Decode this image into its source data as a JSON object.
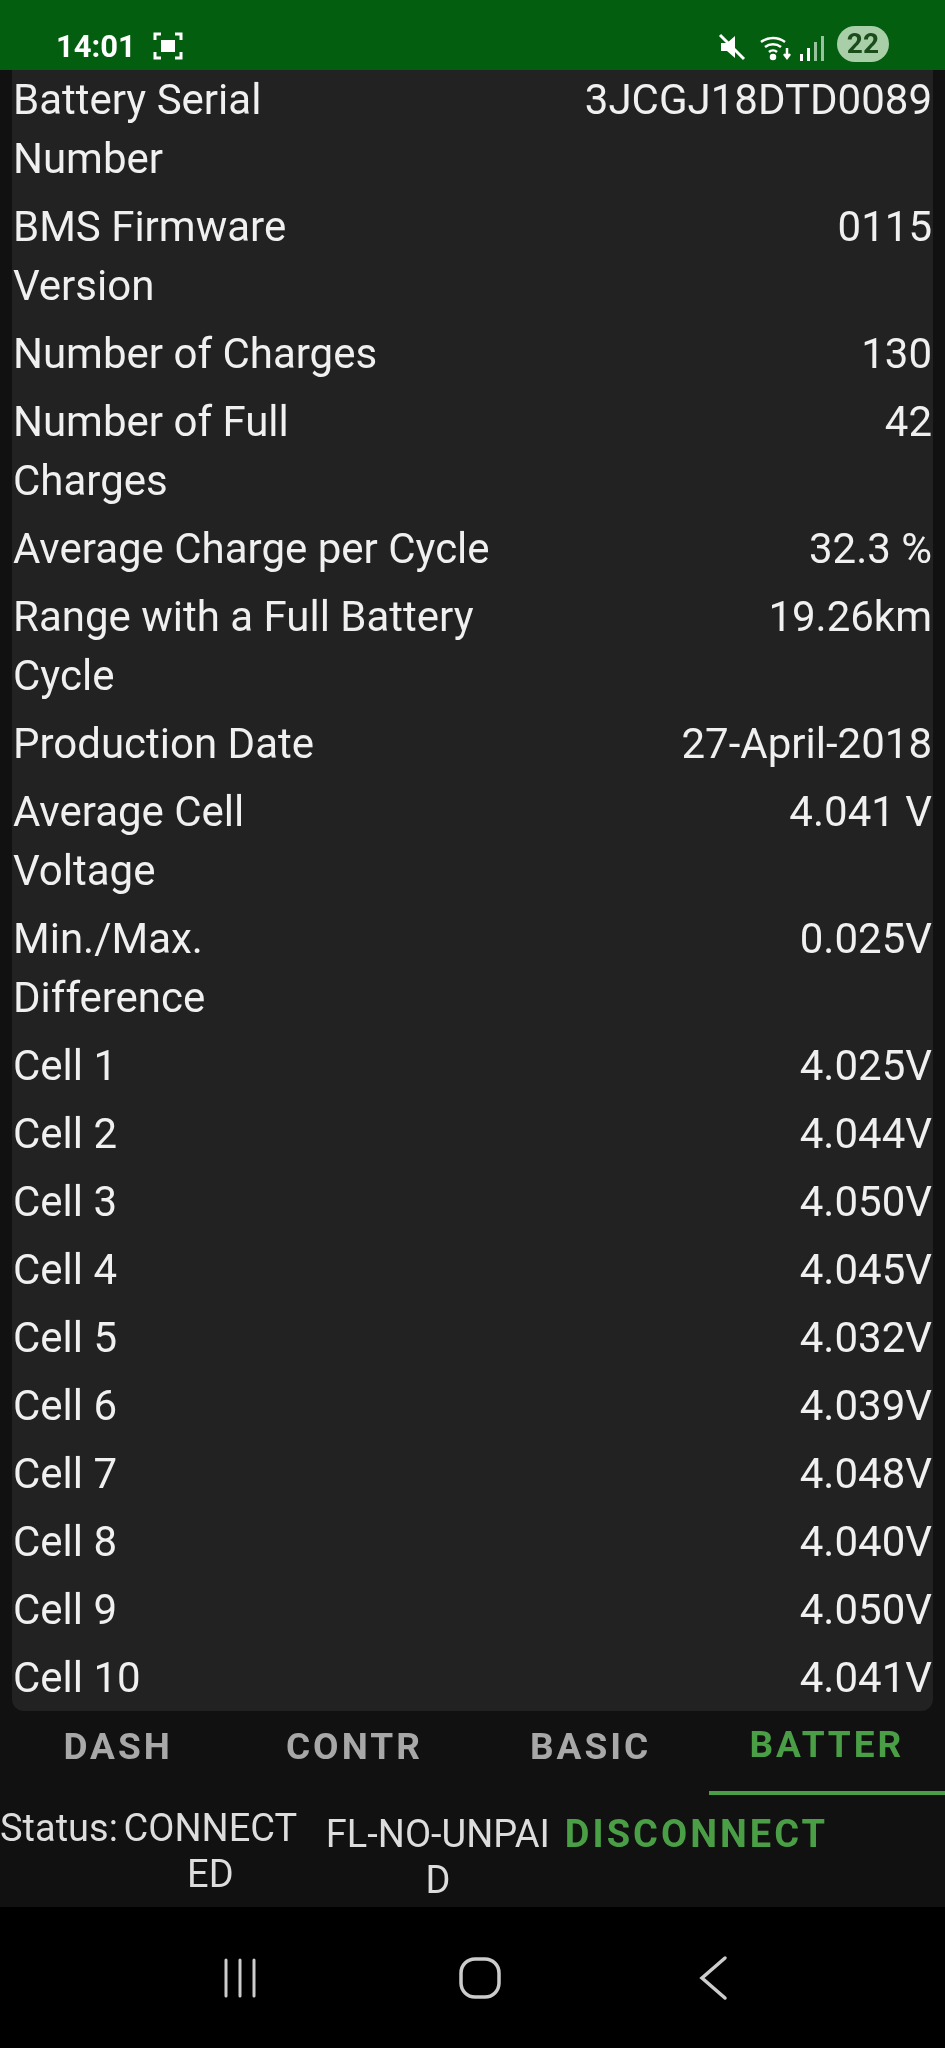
{
  "status_bar": {
    "time": "14:01",
    "battery": "22"
  },
  "rows": [
    {
      "label": "Battery Serial\nNumber",
      "value": "3JCGJ18DTD0089"
    },
    {
      "label": "BMS Firmware\nVersion",
      "value": "0115"
    },
    {
      "label": "Number of Charges",
      "value": "130"
    },
    {
      "label": "Number of Full\nCharges",
      "value": "42"
    },
    {
      "label": "Average Charge per Cycle",
      "value": "32.3 %"
    },
    {
      "label": "Range with a Full Battery\nCycle",
      "value": "19.26km"
    },
    {
      "label": "Production Date",
      "value": "27-April-2018"
    },
    {
      "label": "Average Cell\nVoltage",
      "value": "4.041 V"
    },
    {
      "label": "Min./Max.\nDifference",
      "value": "0.025V"
    },
    {
      "label": "Cell 1",
      "value": "4.025V"
    },
    {
      "label": "Cell 2",
      "value": "4.044V"
    },
    {
      "label": "Cell 3",
      "value": "4.050V"
    },
    {
      "label": "Cell 4",
      "value": "4.045V"
    },
    {
      "label": "Cell 5",
      "value": "4.032V"
    },
    {
      "label": "Cell 6",
      "value": "4.039V"
    },
    {
      "label": "Cell 7",
      "value": "4.048V"
    },
    {
      "label": "Cell 8",
      "value": "4.040V"
    },
    {
      "label": "Cell 9",
      "value": "4.050V"
    },
    {
      "label": "Cell 10",
      "value": "4.041V"
    }
  ],
  "tabs": [
    {
      "label": "DASH",
      "selected": false
    },
    {
      "label": "CONTR",
      "selected": false
    },
    {
      "label": "BASIC",
      "selected": false
    },
    {
      "label": "BATTER",
      "selected": true
    }
  ],
  "footer": {
    "status_label": "Status:",
    "status_value": "CONNECTED",
    "device": "FL-NO-UNPAID",
    "button": "DISCONNECT"
  }
}
